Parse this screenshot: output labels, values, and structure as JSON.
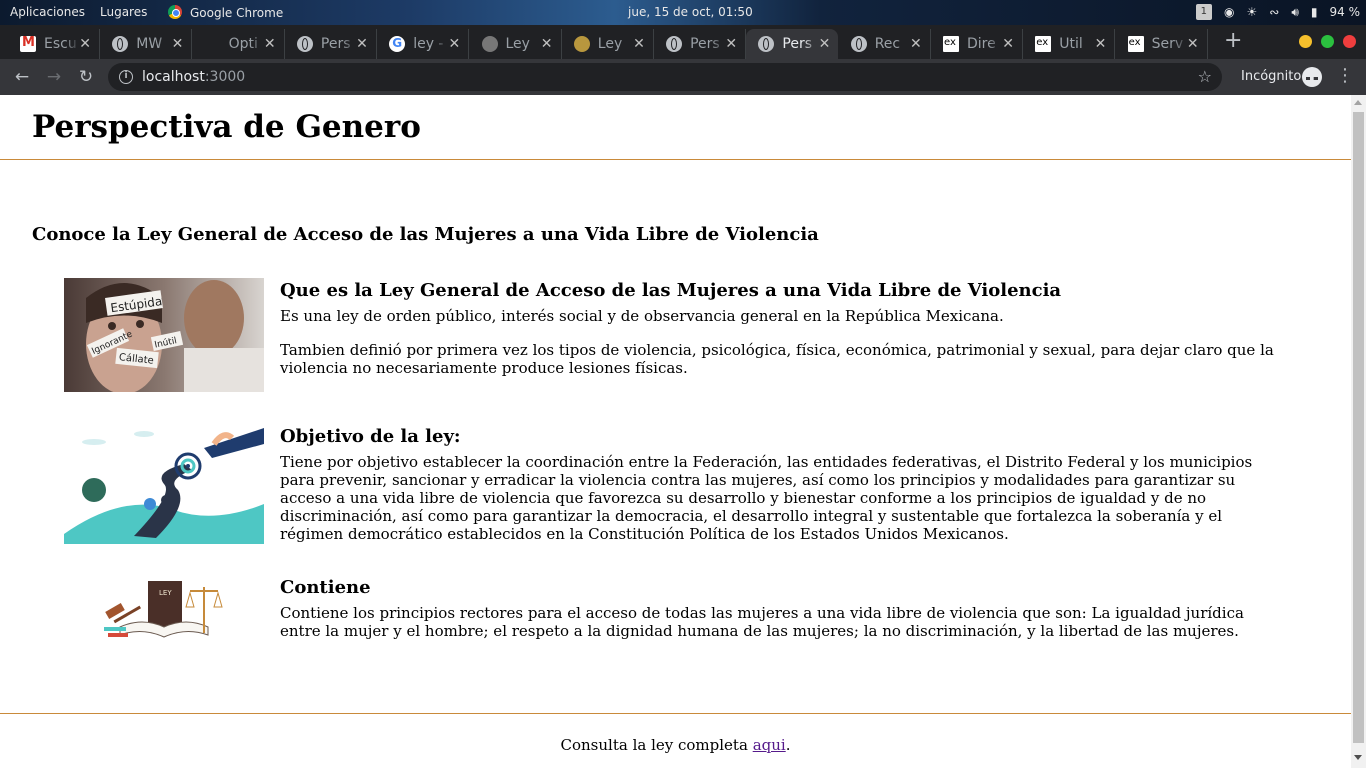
{
  "system_bar": {
    "apps_label": "Aplicaciones",
    "places_label": "Lugares",
    "chrome_label": "Google Chrome",
    "clock": "jue, 15 de oct, 01:50",
    "workspace": "1",
    "battery": "94 %"
  },
  "tabs": [
    {
      "label": "Escu",
      "icon": "gmail-icon"
    },
    {
      "label": "MW",
      "icon": "globe-icon"
    },
    {
      "label": "Opti",
      "icon": "blank-icon"
    },
    {
      "label": "Pers",
      "icon": "globe-icon"
    },
    {
      "label": "ley -",
      "icon": "google-icon"
    },
    {
      "label": "Ley",
      "icon": "seal-icon"
    },
    {
      "label": "Ley",
      "icon": "coin-icon"
    },
    {
      "label": "Pers",
      "icon": "globe-icon"
    },
    {
      "label": "Pers",
      "icon": "globe-icon",
      "active": true
    },
    {
      "label": "Rec",
      "icon": "globe-icon"
    },
    {
      "label": "Dire",
      "icon": "ex-icon"
    },
    {
      "label": "Util",
      "icon": "ex-icon"
    },
    {
      "label": "Serv",
      "icon": "ex-icon"
    }
  ],
  "toolbar": {
    "url_host": "localhost",
    "url_port": ":3000",
    "incognito_label": "Incógnito"
  },
  "page": {
    "title": "Perspectiva de Genero",
    "section_title": "Conoce la Ley General de Acceso de las Mujeres a una Vida Libre de Violencia",
    "cards": [
      {
        "heading": "Que es la Ley General de Acceso de las Mujeres a una Vida Libre de Violencia",
        "paragraphs": [
          "Es una ley de orden público, interés social y de observancia general en la República Mexicana.",
          "Tambien definió por primera vez los tipos de violencia, psicológica, física, económica, patrimonial y sexual, para dejar claro que la violencia no necesariamente produce lesiones físicas."
        ],
        "image_text": [
          "Estúpida",
          "Inútil",
          "Cállate",
          "Ignorante"
        ]
      },
      {
        "heading": "Objetivo de la ley:",
        "paragraphs": [
          "Tiene por objetivo establecer la coordinación entre la Federación, las entidades federativas, el Distrito Federal y los municipios para prevenir, sancionar y erradicar la violencia contra las mujeres, así como los principios y modalidades para garantizar su acceso a una vida libre de violencia que favorezca su desarrollo y bienestar conforme a los principios de igualdad y de no discriminación, así como para garantizar la democracia, el desarrollo integral y sustentable que fortalezca la soberanía y el régimen democrático establecidos en la Constitución Política de los Estados Unidos Mexicanos."
        ]
      },
      {
        "heading": "Contiene",
        "paragraphs": [
          "Contiene los principios rectores para el acceso de todas las mujeres a una vida libre de violencia que son: La igualdad jurídica entre la mujer y el hombre; el respeto a la dignidad humana de las mujeres; la no discriminación, y la libertad de las mujeres."
        ],
        "image_text": [
          "LEY"
        ]
      }
    ],
    "footer_text": "Consulta la ley completa ",
    "footer_link": "aqui",
    "footer_end": "."
  },
  "colors": {
    "rule": "#c98a3a",
    "link": "#551a8b",
    "tab_bg": "#202124",
    "toolbar_bg": "#35363a"
  }
}
